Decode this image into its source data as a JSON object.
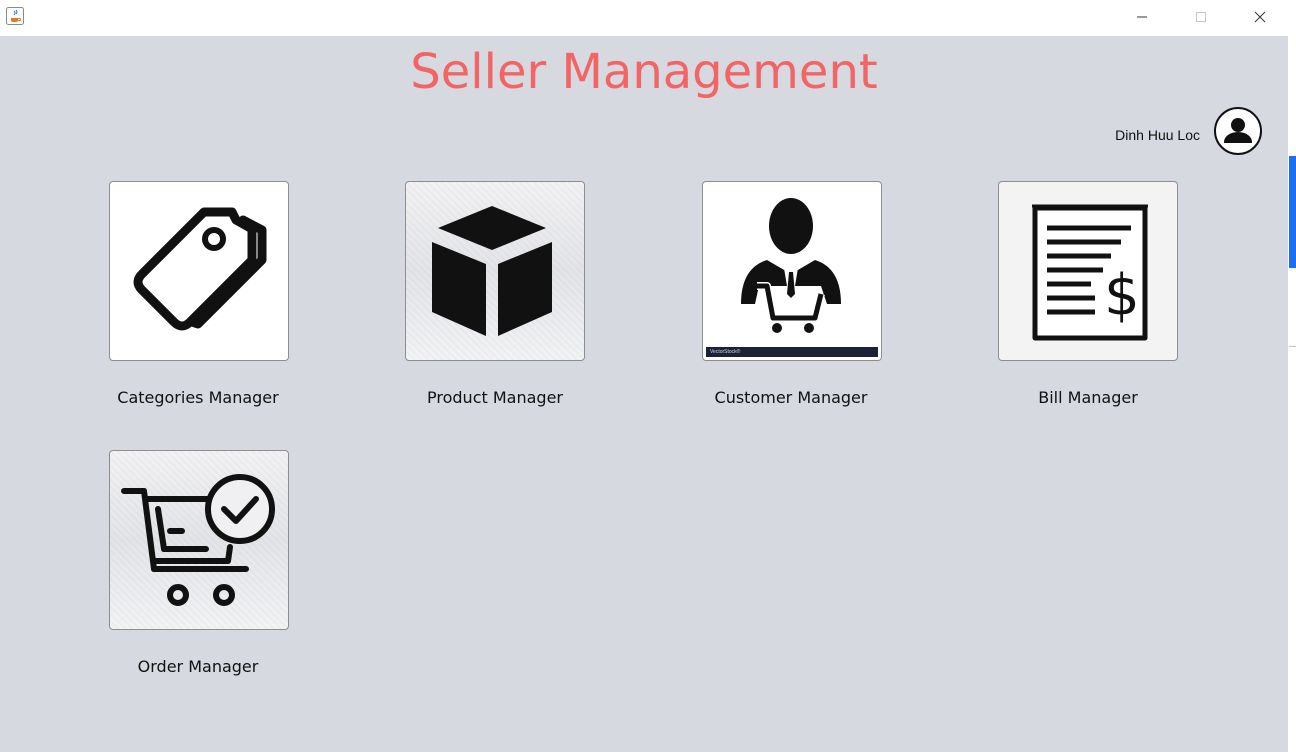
{
  "window": {
    "title": "",
    "controls": [
      "minimize-icon",
      "maximize-icon",
      "close-icon"
    ]
  },
  "header": {
    "title": "Seller Management",
    "title_color": "#f36464"
  },
  "user": {
    "name": "Dinh Huu Loc",
    "avatar_icon": "user-circle-icon"
  },
  "tiles": [
    {
      "label": "Categories Manager",
      "icon": "tag-icon"
    },
    {
      "label": "Product Manager",
      "icon": "box-icon"
    },
    {
      "label": "Customer Manager",
      "icon": "customer-cart-icon",
      "watermark": "VectorStock®"
    },
    {
      "label": "Bill Manager",
      "icon": "bill-icon"
    },
    {
      "label": "Order Manager",
      "icon": "cart-check-icon"
    }
  ],
  "colors": {
    "background": "#d6d9e0",
    "accent": "#1d6ff2"
  }
}
